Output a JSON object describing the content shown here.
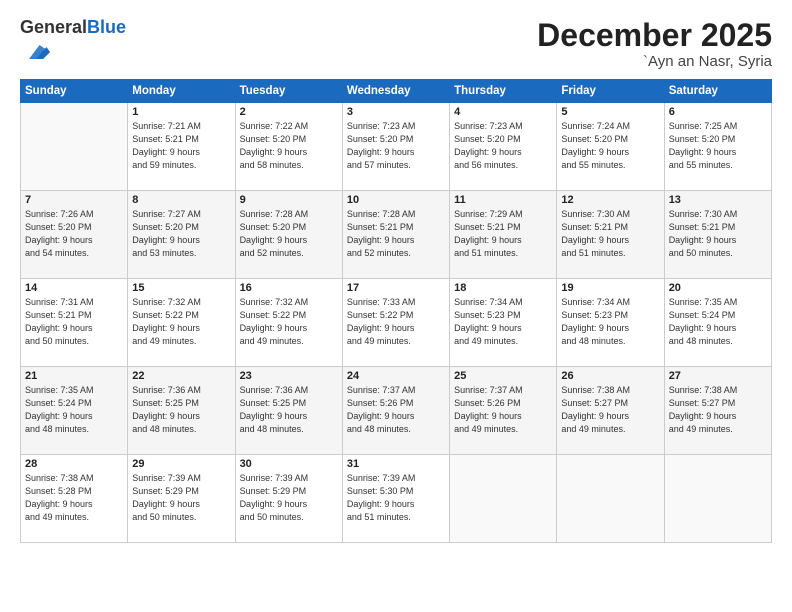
{
  "header": {
    "logo_general": "General",
    "logo_blue": "Blue",
    "month_title": "December 2025",
    "location": "`Ayn an Nasr, Syria"
  },
  "weekdays": [
    "Sunday",
    "Monday",
    "Tuesday",
    "Wednesday",
    "Thursday",
    "Friday",
    "Saturday"
  ],
  "weeks": [
    [
      {
        "day": "",
        "info": ""
      },
      {
        "day": "1",
        "info": "Sunrise: 7:21 AM\nSunset: 5:21 PM\nDaylight: 9 hours\nand 59 minutes."
      },
      {
        "day": "2",
        "info": "Sunrise: 7:22 AM\nSunset: 5:20 PM\nDaylight: 9 hours\nand 58 minutes."
      },
      {
        "day": "3",
        "info": "Sunrise: 7:23 AM\nSunset: 5:20 PM\nDaylight: 9 hours\nand 57 minutes."
      },
      {
        "day": "4",
        "info": "Sunrise: 7:23 AM\nSunset: 5:20 PM\nDaylight: 9 hours\nand 56 minutes."
      },
      {
        "day": "5",
        "info": "Sunrise: 7:24 AM\nSunset: 5:20 PM\nDaylight: 9 hours\nand 55 minutes."
      },
      {
        "day": "6",
        "info": "Sunrise: 7:25 AM\nSunset: 5:20 PM\nDaylight: 9 hours\nand 55 minutes."
      }
    ],
    [
      {
        "day": "7",
        "info": "Sunrise: 7:26 AM\nSunset: 5:20 PM\nDaylight: 9 hours\nand 54 minutes."
      },
      {
        "day": "8",
        "info": "Sunrise: 7:27 AM\nSunset: 5:20 PM\nDaylight: 9 hours\nand 53 minutes."
      },
      {
        "day": "9",
        "info": "Sunrise: 7:28 AM\nSunset: 5:20 PM\nDaylight: 9 hours\nand 52 minutes."
      },
      {
        "day": "10",
        "info": "Sunrise: 7:28 AM\nSunset: 5:21 PM\nDaylight: 9 hours\nand 52 minutes."
      },
      {
        "day": "11",
        "info": "Sunrise: 7:29 AM\nSunset: 5:21 PM\nDaylight: 9 hours\nand 51 minutes."
      },
      {
        "day": "12",
        "info": "Sunrise: 7:30 AM\nSunset: 5:21 PM\nDaylight: 9 hours\nand 51 minutes."
      },
      {
        "day": "13",
        "info": "Sunrise: 7:30 AM\nSunset: 5:21 PM\nDaylight: 9 hours\nand 50 minutes."
      }
    ],
    [
      {
        "day": "14",
        "info": "Sunrise: 7:31 AM\nSunset: 5:21 PM\nDaylight: 9 hours\nand 50 minutes."
      },
      {
        "day": "15",
        "info": "Sunrise: 7:32 AM\nSunset: 5:22 PM\nDaylight: 9 hours\nand 49 minutes."
      },
      {
        "day": "16",
        "info": "Sunrise: 7:32 AM\nSunset: 5:22 PM\nDaylight: 9 hours\nand 49 minutes."
      },
      {
        "day": "17",
        "info": "Sunrise: 7:33 AM\nSunset: 5:22 PM\nDaylight: 9 hours\nand 49 minutes."
      },
      {
        "day": "18",
        "info": "Sunrise: 7:34 AM\nSunset: 5:23 PM\nDaylight: 9 hours\nand 49 minutes."
      },
      {
        "day": "19",
        "info": "Sunrise: 7:34 AM\nSunset: 5:23 PM\nDaylight: 9 hours\nand 48 minutes."
      },
      {
        "day": "20",
        "info": "Sunrise: 7:35 AM\nSunset: 5:24 PM\nDaylight: 9 hours\nand 48 minutes."
      }
    ],
    [
      {
        "day": "21",
        "info": "Sunrise: 7:35 AM\nSunset: 5:24 PM\nDaylight: 9 hours\nand 48 minutes."
      },
      {
        "day": "22",
        "info": "Sunrise: 7:36 AM\nSunset: 5:25 PM\nDaylight: 9 hours\nand 48 minutes."
      },
      {
        "day": "23",
        "info": "Sunrise: 7:36 AM\nSunset: 5:25 PM\nDaylight: 9 hours\nand 48 minutes."
      },
      {
        "day": "24",
        "info": "Sunrise: 7:37 AM\nSunset: 5:26 PM\nDaylight: 9 hours\nand 48 minutes."
      },
      {
        "day": "25",
        "info": "Sunrise: 7:37 AM\nSunset: 5:26 PM\nDaylight: 9 hours\nand 49 minutes."
      },
      {
        "day": "26",
        "info": "Sunrise: 7:38 AM\nSunset: 5:27 PM\nDaylight: 9 hours\nand 49 minutes."
      },
      {
        "day": "27",
        "info": "Sunrise: 7:38 AM\nSunset: 5:27 PM\nDaylight: 9 hours\nand 49 minutes."
      }
    ],
    [
      {
        "day": "28",
        "info": "Sunrise: 7:38 AM\nSunset: 5:28 PM\nDaylight: 9 hours\nand 49 minutes."
      },
      {
        "day": "29",
        "info": "Sunrise: 7:39 AM\nSunset: 5:29 PM\nDaylight: 9 hours\nand 50 minutes."
      },
      {
        "day": "30",
        "info": "Sunrise: 7:39 AM\nSunset: 5:29 PM\nDaylight: 9 hours\nand 50 minutes."
      },
      {
        "day": "31",
        "info": "Sunrise: 7:39 AM\nSunset: 5:30 PM\nDaylight: 9 hours\nand 51 minutes."
      },
      {
        "day": "",
        "info": ""
      },
      {
        "day": "",
        "info": ""
      },
      {
        "day": "",
        "info": ""
      }
    ]
  ]
}
